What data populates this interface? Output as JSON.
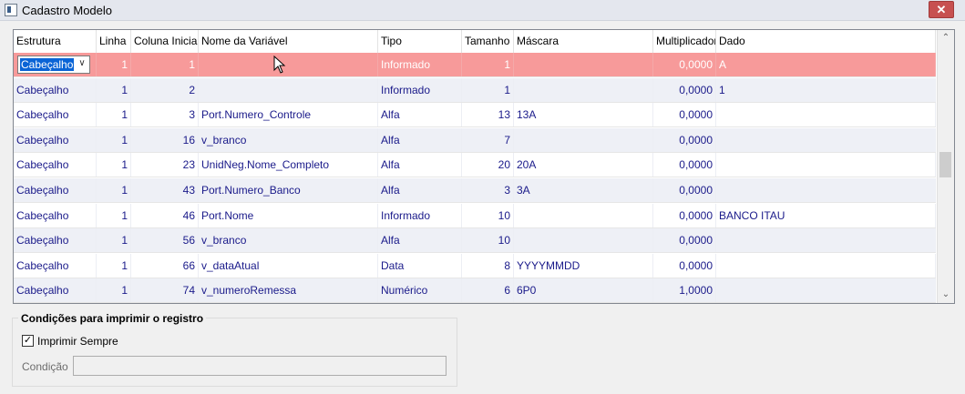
{
  "window": {
    "title": "Cadastro Modelo",
    "close_glyph": "✕"
  },
  "grid": {
    "columns": [
      "Estrutura",
      "Linha",
      "Coluna Inicial",
      "Nome da Variável",
      "Tipo",
      "Tamanho",
      "Máscara",
      "Multiplicador",
      "Dado"
    ],
    "rows": [
      [
        "Cabeçalho",
        "1",
        "1",
        "",
        "Informado",
        "1",
        "",
        "0,0000",
        "A"
      ],
      [
        "Cabeçalho",
        "1",
        "2",
        "",
        "Informado",
        "1",
        "",
        "0,0000",
        "1"
      ],
      [
        "Cabeçalho",
        "1",
        "3",
        "Port.Numero_Controle",
        "Alfa",
        "13",
        "13A",
        "0,0000",
        ""
      ],
      [
        "Cabeçalho",
        "1",
        "16",
        "v_branco",
        "Alfa",
        "7",
        "",
        "0,0000",
        ""
      ],
      [
        "Cabeçalho",
        "1",
        "23",
        "UnidNeg.Nome_Completo",
        "Alfa",
        "20",
        "20A",
        "0,0000",
        ""
      ],
      [
        "Cabeçalho",
        "1",
        "43",
        "Port.Numero_Banco",
        "Alfa",
        "3",
        "3A",
        "0,0000",
        ""
      ],
      [
        "Cabeçalho",
        "1",
        "46",
        "Port.Nome",
        "Informado",
        "10",
        "",
        "0,0000",
        "BANCO ITAU"
      ],
      [
        "Cabeçalho",
        "1",
        "56",
        "v_branco",
        "Alfa",
        "10",
        "",
        "0,0000",
        ""
      ],
      [
        "Cabeçalho",
        "1",
        "66",
        "v_dataAtual",
        "Data",
        "8",
        "YYYYMMDD",
        "0,0000",
        ""
      ],
      [
        "Cabeçalho",
        "1",
        "74",
        "v_numeroRemessa",
        "Numérico",
        "6",
        "6P0",
        "1,0000",
        ""
      ]
    ],
    "selected_row": 0,
    "editor_value": "Cabeçalho",
    "scroll_up_glyph": "⌃",
    "scroll_down_glyph": "⌄",
    "combo_arrow_glyph": "∨"
  },
  "conditions": {
    "title": "Condições para imprimir o registro",
    "always_print_label": "Imprimir Sempre",
    "always_print_checked": true,
    "check_glyph": "✓",
    "condition_label": "Condição",
    "condition_value": ""
  },
  "colors": {
    "selected_row": "#f79a9a",
    "alt_row": "#eef0f6",
    "text": "#1a1a8a"
  }
}
